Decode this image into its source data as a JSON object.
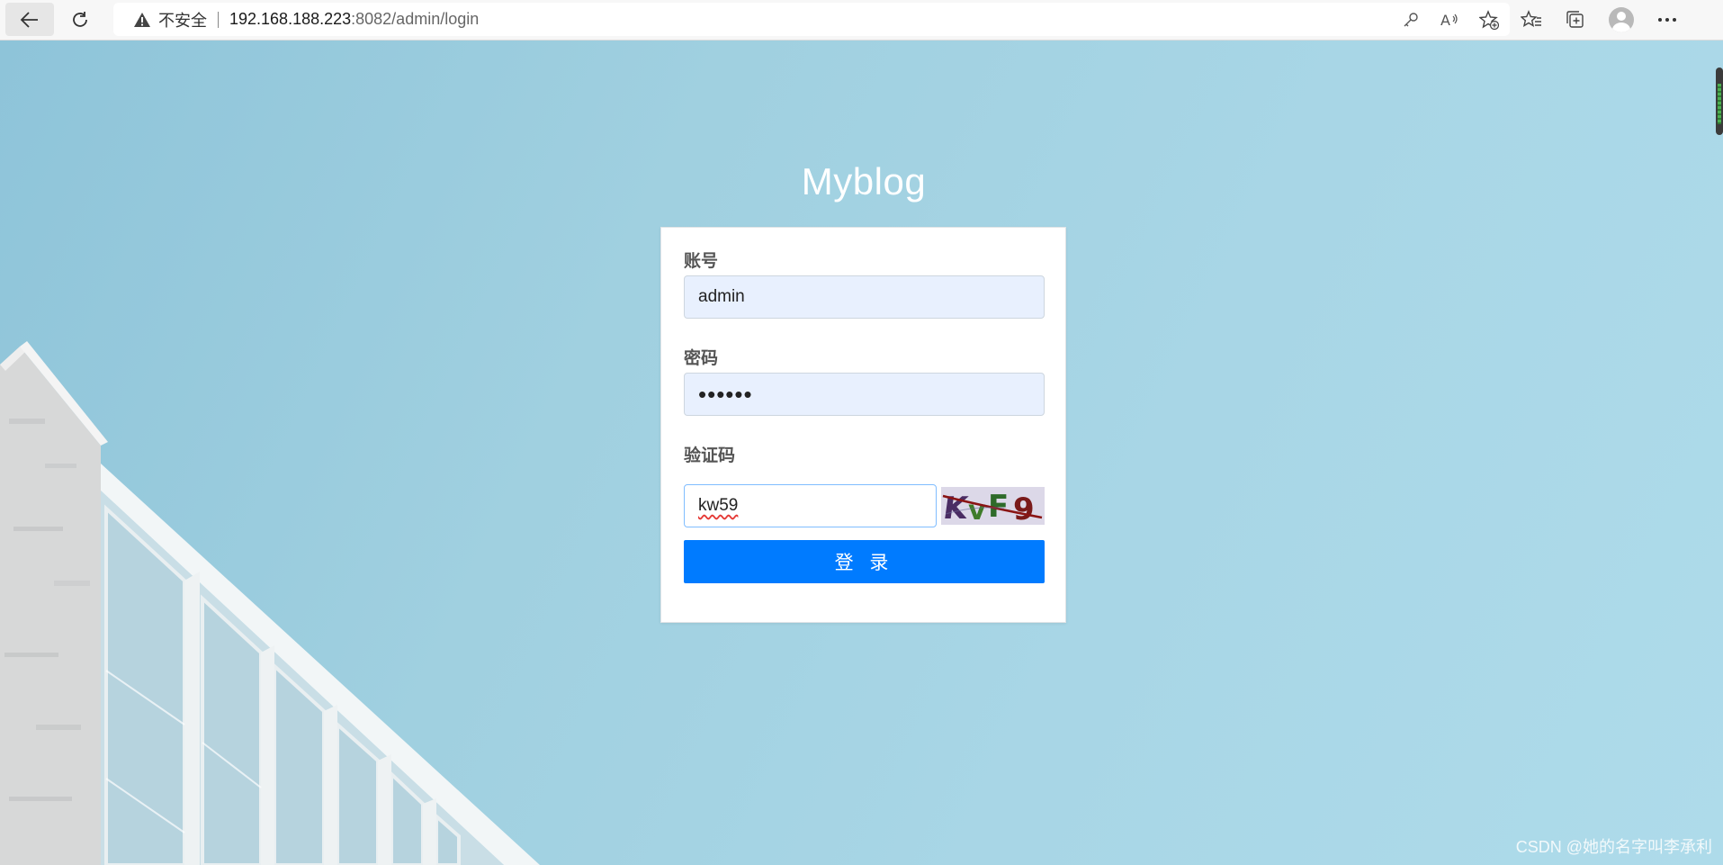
{
  "browser": {
    "address_insecure_label": "不安全",
    "url_host": "192.168.188.223",
    "url_rest": ":8082/admin/login",
    "icons": [
      "back-arrow-icon",
      "reload-icon",
      "warning-icon",
      "key-icon",
      "read-aloud-icon",
      "add-favorite-icon",
      "favorites-icon",
      "collections-icon",
      "profile-avatar-icon",
      "more-icon"
    ]
  },
  "page": {
    "title": "Myblog",
    "form": {
      "account_label": "账号",
      "account_value": "admin",
      "password_label": "密码",
      "password_value": "••••••",
      "captcha_label": "验证码",
      "captcha_value": "kw59",
      "captcha_image_text": "KvF9",
      "login_button": "登 录"
    },
    "watermark": "CSDN @她的名字叫李承利"
  },
  "colors": {
    "primary": "#007bff",
    "autofill_bg": "#e8f0fe",
    "sky": "#a8d6e6"
  }
}
